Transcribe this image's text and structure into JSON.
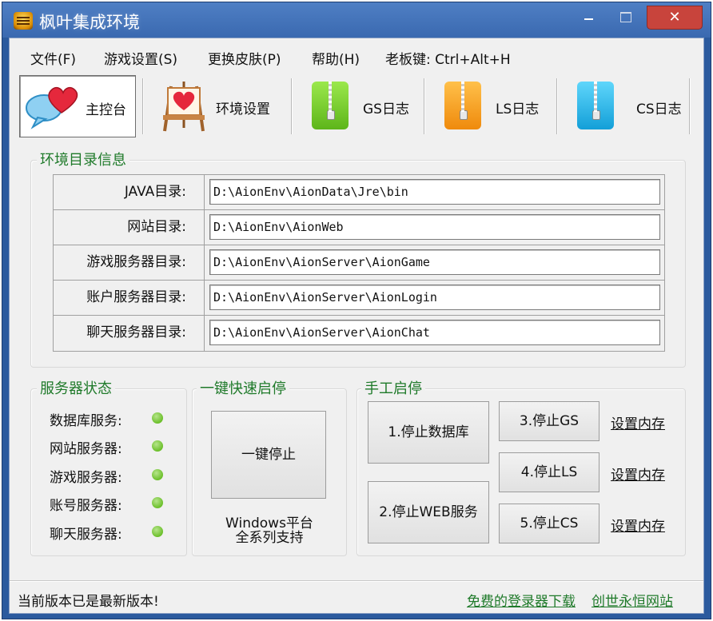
{
  "window": {
    "title": "枫叶集成环境",
    "close_glyph": "✕"
  },
  "menu": {
    "items": [
      "文件(F)",
      "游戏设置(S)",
      "更换皮肤(P)",
      "帮助(H)"
    ],
    "boss_key": "老板键: Ctrl+Alt+H"
  },
  "toolbar": {
    "tabs": [
      {
        "label": "主控台",
        "icon": "chat-hearts-icon"
      },
      {
        "label": "环境设置",
        "icon": "easel-icon"
      },
      {
        "label": "GS日志",
        "icon": "green-zip-folder-icon",
        "color": "#6ccf24"
      },
      {
        "label": "LS日志",
        "icon": "orange-zip-folder-icon",
        "color": "#f49b12"
      },
      {
        "label": "CS日志",
        "icon": "blue-zip-folder-icon",
        "color": "#1eb6ee"
      }
    ],
    "active": 0
  },
  "env_dirs": {
    "title": "环境目录信息",
    "rows": [
      {
        "label": "JAVA目录:",
        "value": "D:\\AionEnv\\AionData\\Jre\\bin"
      },
      {
        "label": "网站目录:",
        "value": "D:\\AionEnv\\AionWeb"
      },
      {
        "label": "游戏服务器目录:",
        "value": "D:\\AionEnv\\AionServer\\AionGame"
      },
      {
        "label": "账户服务器目录:",
        "value": "D:\\AionEnv\\AionServer\\AionLogin"
      },
      {
        "label": "聊天服务器目录:",
        "value": "D:\\AionEnv\\AionServer\\AionChat"
      }
    ]
  },
  "server_status": {
    "title": "服务器状态",
    "items": [
      "数据库服务:",
      "网站服务器:",
      "游戏服务器:",
      "账号服务器:",
      "聊天服务器:"
    ],
    "dot_color": "#6bbf2a"
  },
  "quick": {
    "title": "一键快速启停",
    "button": "一键停止",
    "note_line1": "Windows平台",
    "note_line2": "全系列支持"
  },
  "manual": {
    "title": "手工启停",
    "stop_db": "1.停止数据库",
    "stop_web": "2.停止WEB服务",
    "stop_gs": "3.停止GS",
    "stop_ls": "4.停止LS",
    "stop_cs": "5.停止CS",
    "mem_link": "设置内存"
  },
  "statusbar": {
    "message": "当前版本已是最新版本!",
    "link_login": "免费的登录器下载",
    "link_site": "创世永恒网站"
  }
}
